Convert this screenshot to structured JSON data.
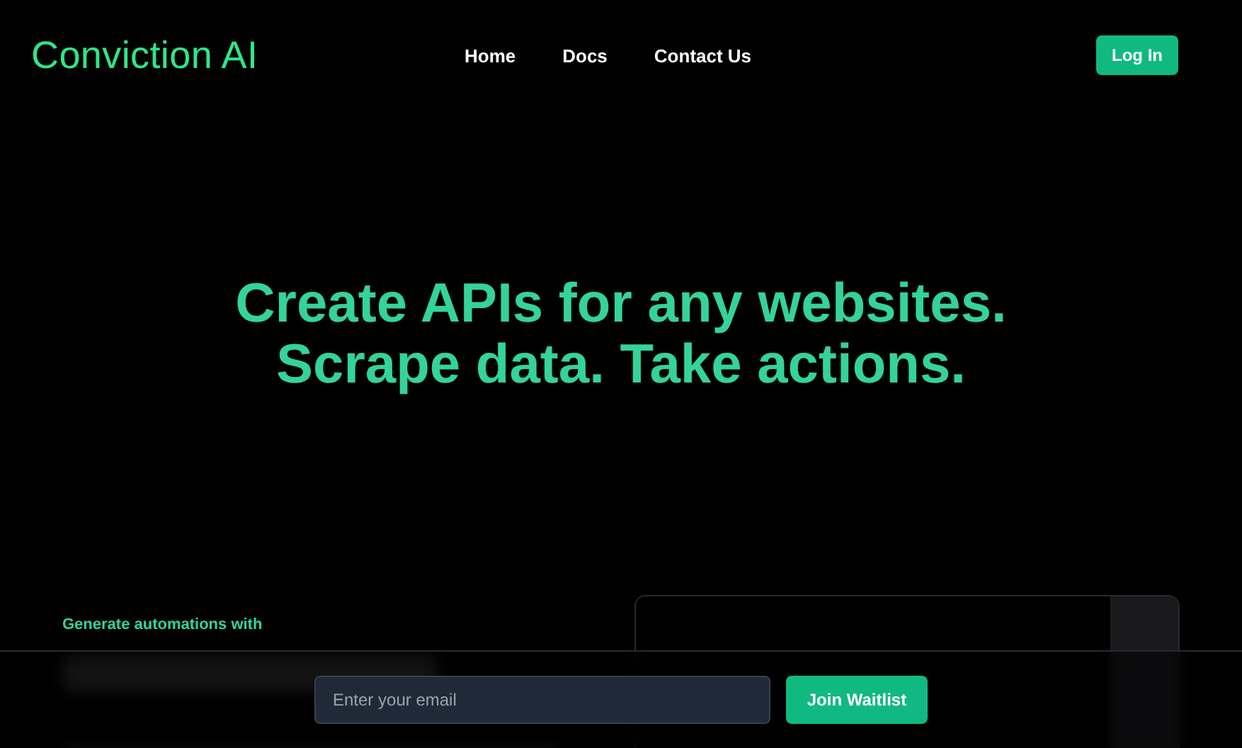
{
  "header": {
    "logo": "Conviction AI",
    "nav": [
      {
        "label": "Home"
      },
      {
        "label": "Docs"
      },
      {
        "label": "Contact Us"
      }
    ],
    "login": "Log In"
  },
  "hero": {
    "lines": [
      "Create APIs for any websites.",
      "Scrape data. Take actions."
    ]
  },
  "feature": {
    "eyebrow": "Generate automations with"
  },
  "waitlist": {
    "placeholder": "Enter your email",
    "button": "Join Waitlist"
  }
}
